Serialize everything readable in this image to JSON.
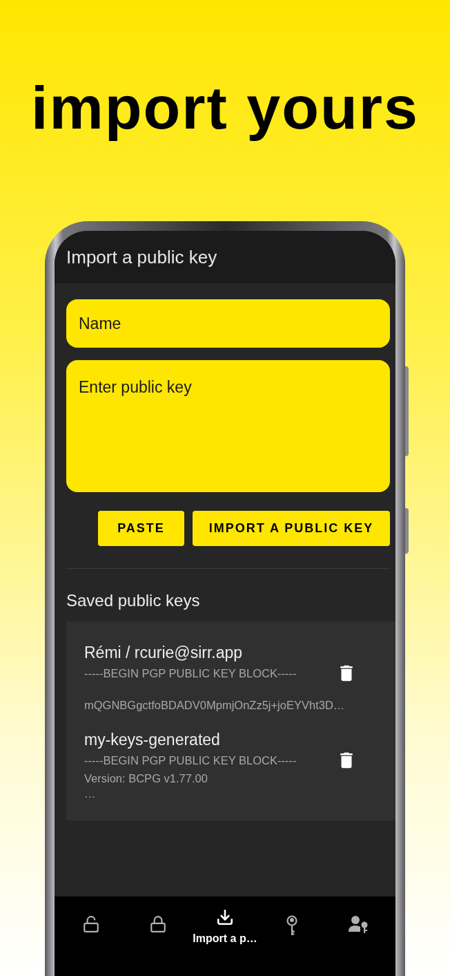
{
  "headline": "import yours",
  "app_bar": {
    "title": "Import a public key"
  },
  "name_field": {
    "placeholder": "Name"
  },
  "key_field": {
    "placeholder": "Enter public key"
  },
  "buttons": [
    {
      "label": "PASTE"
    },
    {
      "label": "IMPORT A PUBLIC KEY"
    }
  ],
  "saved_section": {
    "title": "Saved public keys",
    "keys": [
      {
        "name": "Rémi / rcurie@sirr.app",
        "preview": "-----BEGIN PGP PUBLIC KEY BLOCK-----\n\nmQGNBGgctfoBDADV0MpmjOnZz5j+joEYVht3D…"
      },
      {
        "name": "my-keys-generated",
        "preview": "-----BEGIN PGP PUBLIC KEY BLOCK-----\nVersion: BCPG v1.77.00\n…"
      }
    ]
  },
  "bottom_nav": [
    {
      "kind": "unlock",
      "selected": false
    },
    {
      "kind": "lock",
      "selected": false
    },
    {
      "kind": "import",
      "selected": true,
      "label": "Import a p…"
    },
    {
      "kind": "key",
      "selected": false
    },
    {
      "kind": "contact-key",
      "selected": false
    }
  ]
}
